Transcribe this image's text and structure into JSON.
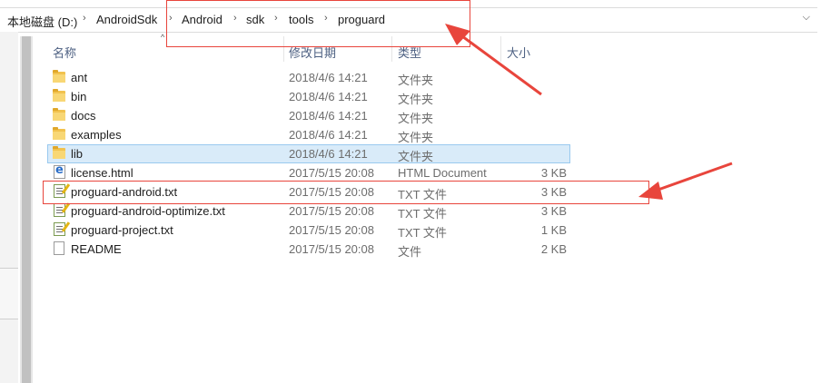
{
  "address_bar": {
    "crumbs": [
      "本地磁盘 (D:)",
      "AndroidSdk",
      "Android",
      "sdk",
      "tools",
      "proguard"
    ]
  },
  "columns": {
    "name": "名称",
    "date": "修改日期",
    "type": "类型",
    "size": "大小"
  },
  "files": [
    {
      "name": "ant",
      "date": "2018/4/6 14:21",
      "type": "文件夹",
      "size": "",
      "icon": "folder-icon"
    },
    {
      "name": "bin",
      "date": "2018/4/6 14:21",
      "type": "文件夹",
      "size": "",
      "icon": "folder-icon"
    },
    {
      "name": "docs",
      "date": "2018/4/6 14:21",
      "type": "文件夹",
      "size": "",
      "icon": "folder-icon"
    },
    {
      "name": "examples",
      "date": "2018/4/6 14:21",
      "type": "文件夹",
      "size": "",
      "icon": "folder-icon"
    },
    {
      "name": "lib",
      "date": "2018/4/6 14:21",
      "type": "文件夹",
      "size": "",
      "icon": "folder-icon"
    },
    {
      "name": "license.html",
      "date": "2017/5/15 20:08",
      "type": "HTML Document",
      "size": "3 KB",
      "icon": "html-file-icon"
    },
    {
      "name": "proguard-android.txt",
      "date": "2017/5/15 20:08",
      "type": "TXT 文件",
      "size": "3 KB",
      "icon": "text-file-icon"
    },
    {
      "name": "proguard-android-optimize.txt",
      "date": "2017/5/15 20:08",
      "type": "TXT 文件",
      "size": "3 KB",
      "icon": "text-file-icon"
    },
    {
      "name": "proguard-project.txt",
      "date": "2017/5/15 20:08",
      "type": "TXT 文件",
      "size": "1 KB",
      "icon": "text-file-icon"
    },
    {
      "name": "README",
      "date": "2017/5/15 20:08",
      "type": "文件",
      "size": "2 KB",
      "icon": "blank-file-icon"
    }
  ],
  "selected_file": "lib",
  "annotation_color": "#e8453c",
  "header_color": "#4d6082",
  "selection_color": "#d9ebf9"
}
